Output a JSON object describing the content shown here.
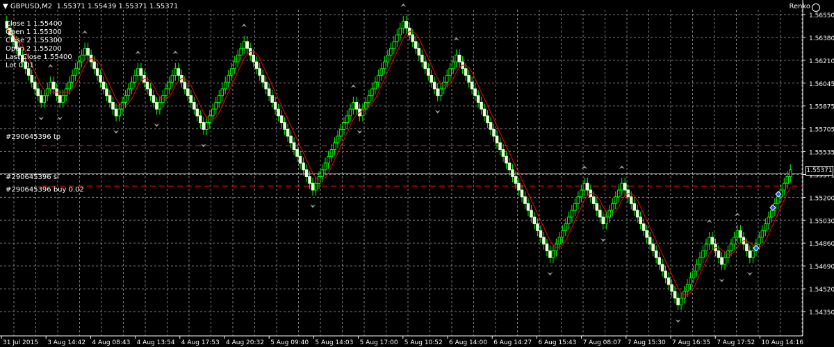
{
  "header": {
    "menu_arrow": "▼",
    "symbol": "GBPUSD,M2",
    "ohlc": "1.55371 1.55439 1.55371 1.55371",
    "indicator": "Renko",
    "indicator_icon": "smiley-icon"
  },
  "info_lines": [
    "Close 1 1.55400",
    "Open 1 1.55300",
    "Close 2 1.55300",
    "Open 2 1.55200",
    "Last Close 1.55400",
    "Lot 0.01"
  ],
  "order_labels": {
    "tp": "#290645396 tp",
    "sl": "#290645396 sl",
    "buy": "#290645396 buy 0.02"
  },
  "price_axis": [
    "1.56550",
    "1.56380",
    "1.56210",
    "1.56045",
    "1.55875",
    "1.55705",
    "1.55535",
    "1.55371",
    "1.55200",
    "1.55030",
    "1.54860",
    "1.54690",
    "1.54520",
    "1.54350"
  ],
  "current_price": "1.55371",
  "time_axis": [
    "31 Jul 2015",
    "3 Aug 14:42",
    "4 Aug 08:43",
    "4 Aug 13:54",
    "4 Aug 17:53",
    "4 Aug 20:32",
    "5 Aug 09:40",
    "5 Aug 14:03",
    "5 Aug 17:00",
    "5 Aug 10:52",
    "6 Aug 14:00",
    "6 Aug 14:27",
    "6 Aug 15:43",
    "7 Aug 08:07",
    "7 Aug 15:30",
    "7 Aug 16:35",
    "7 Aug 17:52",
    "10 Aug 14:16"
  ],
  "colors": {
    "background": "#000000",
    "grid": "#7f7f7f",
    "bull_body": "#000000",
    "bull_border": "#00ff00",
    "bear_body": "#e6ffd2",
    "ma_line": "#ff0000",
    "order_line": "#ff0000",
    "arrow": "#a0a0a0",
    "text": "#ffffff"
  },
  "renko_close_series": [
    1.5645,
    1.564,
    1.5635,
    1.563,
    1.5625,
    1.562,
    1.5615,
    1.561,
    1.5605,
    1.56,
    1.5595,
    1.559,
    1.5595,
    1.56,
    1.5605,
    1.56,
    1.5595,
    1.559,
    1.5595,
    1.56,
    1.5605,
    1.561,
    1.5615,
    1.562,
    1.5625,
    1.563,
    1.5625,
    1.562,
    1.5615,
    1.561,
    1.5605,
    1.56,
    1.5595,
    1.559,
    1.5585,
    1.558,
    1.5585,
    1.559,
    1.5595,
    1.56,
    1.5605,
    1.561,
    1.5615,
    1.561,
    1.5605,
    1.56,
    1.5595,
    1.559,
    1.5585,
    1.559,
    1.5595,
    1.56,
    1.5605,
    1.561,
    1.5615,
    1.561,
    1.5605,
    1.56,
    1.5595,
    1.559,
    1.5585,
    1.558,
    1.5575,
    1.557,
    1.5575,
    1.558,
    1.5585,
    1.559,
    1.5595,
    1.56,
    1.5605,
    1.561,
    1.5615,
    1.562,
    1.5625,
    1.563,
    1.5635,
    1.563,
    1.5625,
    1.562,
    1.5615,
    1.561,
    1.5605,
    1.56,
    1.5595,
    1.559,
    1.5585,
    1.558,
    1.5575,
    1.557,
    1.5565,
    1.556,
    1.5555,
    1.555,
    1.5545,
    1.554,
    1.5535,
    1.553,
    1.5525,
    1.553,
    1.5535,
    1.554,
    1.5545,
    1.555,
    1.5555,
    1.556,
    1.5565,
    1.557,
    1.5575,
    1.558,
    1.5585,
    1.559,
    1.5585,
    1.558,
    1.5585,
    1.559,
    1.5595,
    1.56,
    1.5605,
    1.561,
    1.5615,
    1.562,
    1.5625,
    1.563,
    1.5635,
    1.564,
    1.5645,
    1.565,
    1.5645,
    1.564,
    1.5635,
    1.563,
    1.5625,
    1.562,
    1.5615,
    1.561,
    1.5605,
    1.56,
    1.5595,
    1.56,
    1.5605,
    1.561,
    1.5615,
    1.562,
    1.5625,
    1.562,
    1.5615,
    1.561,
    1.5605,
    1.56,
    1.5595,
    1.559,
    1.5585,
    1.558,
    1.5575,
    1.557,
    1.5565,
    1.556,
    1.5555,
    1.555,
    1.5545,
    1.554,
    1.5535,
    1.553,
    1.5525,
    1.552,
    1.5515,
    1.551,
    1.5505,
    1.55,
    1.5495,
    1.549,
    1.5485,
    1.548,
    1.5475,
    1.548,
    1.5485,
    1.549,
    1.5495,
    1.55,
    1.5505,
    1.551,
    1.5515,
    1.552,
    1.5525,
    1.553,
    1.5525,
    1.552,
    1.5515,
    1.551,
    1.5505,
    1.55,
    1.5505,
    1.551,
    1.5515,
    1.552,
    1.5525,
    1.553,
    1.5525,
    1.552,
    1.5515,
    1.551,
    1.5505,
    1.55,
    1.5495,
    1.549,
    1.5485,
    1.548,
    1.5475,
    1.547,
    1.5465,
    1.546,
    1.5455,
    1.545,
    1.5445,
    1.544,
    1.5445,
    1.545,
    1.5455,
    1.546,
    1.5465,
    1.547,
    1.5475,
    1.548,
    1.5485,
    1.549,
    1.5485,
    1.548,
    1.5475,
    1.547,
    1.5475,
    1.548,
    1.5485,
    1.549,
    1.5495,
    1.549,
    1.5485,
    1.548,
    1.5475,
    1.548,
    1.5485,
    1.549,
    1.5495,
    1.55,
    1.5505,
    1.551,
    1.5515,
    1.552,
    1.5525,
    1.553,
    1.5535,
    1.554
  ]
}
